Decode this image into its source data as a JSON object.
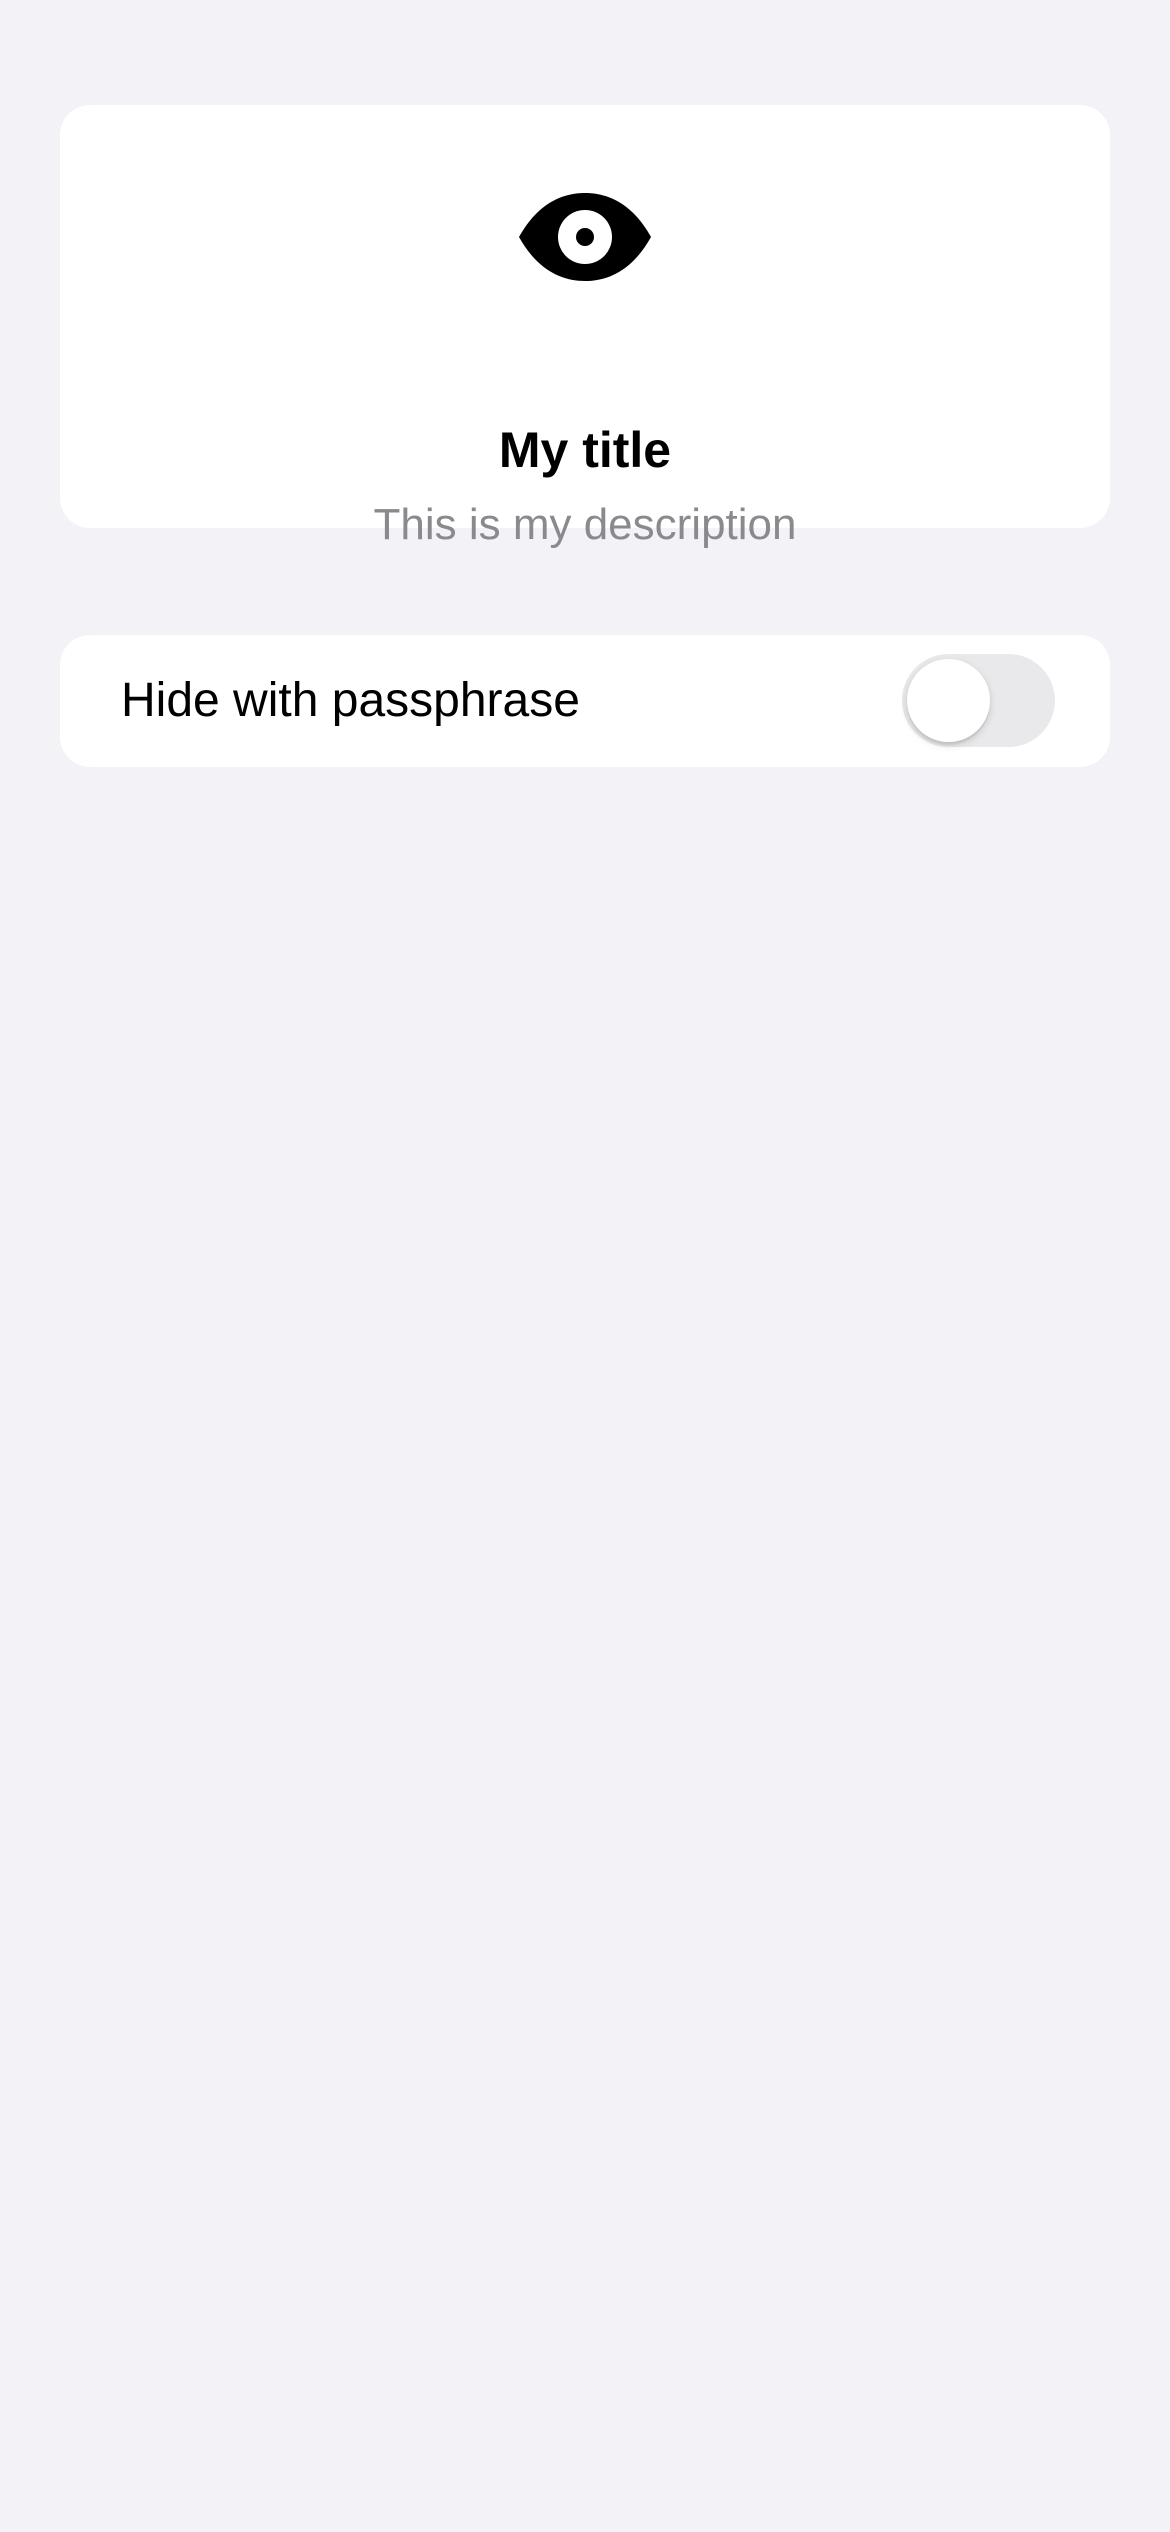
{
  "header": {
    "icon": "eye-icon",
    "title": "My title",
    "description": "This is my description"
  },
  "settings": {
    "items": [
      {
        "label": "Hide with passphrase",
        "control": "toggle",
        "enabled": false
      }
    ]
  },
  "colors": {
    "background": "#f2f2f7",
    "card": "#ffffff",
    "title": "#000000",
    "description": "#8a8a8e",
    "toggle_off_track": "#e9e9eb"
  }
}
